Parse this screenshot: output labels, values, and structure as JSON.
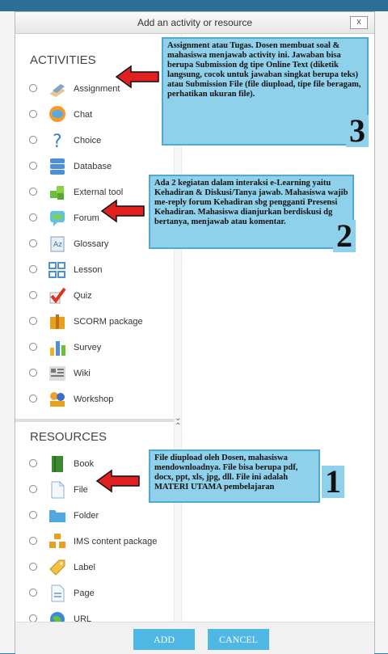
{
  "dialog": {
    "title": "Add an activity or resource",
    "close": "x",
    "add_label": "ADD",
    "cancel_label": "CANCEL"
  },
  "activities": {
    "title": "ACTIVITIES",
    "items": [
      {
        "label": "Assignment",
        "icon": "assignment-icon"
      },
      {
        "label": "Chat",
        "icon": "chat-icon"
      },
      {
        "label": "Choice",
        "icon": "choice-icon"
      },
      {
        "label": "Database",
        "icon": "database-icon"
      },
      {
        "label": "External tool",
        "icon": "external-tool-icon"
      },
      {
        "label": "Forum",
        "icon": "forum-icon"
      },
      {
        "label": "Glossary",
        "icon": "glossary-icon"
      },
      {
        "label": "Lesson",
        "icon": "lesson-icon"
      },
      {
        "label": "Quiz",
        "icon": "quiz-icon"
      },
      {
        "label": "SCORM package",
        "icon": "scorm-icon"
      },
      {
        "label": "Survey",
        "icon": "survey-icon"
      },
      {
        "label": "Wiki",
        "icon": "wiki-icon"
      },
      {
        "label": "Workshop",
        "icon": "workshop-icon"
      }
    ]
  },
  "resources": {
    "title": "RESOURCES",
    "items": [
      {
        "label": "Book",
        "icon": "book-icon"
      },
      {
        "label": "File",
        "icon": "file-icon"
      },
      {
        "label": "Folder",
        "icon": "folder-icon"
      },
      {
        "label": "IMS content package",
        "icon": "ims-icon"
      },
      {
        "label": "Label",
        "icon": "label-icon"
      },
      {
        "label": "Page",
        "icon": "page-icon"
      },
      {
        "label": "URL",
        "icon": "url-icon"
      }
    ]
  },
  "callouts": {
    "c3": {
      "text": "Assignment atau Tugas. Dosen membuat soal & mahasiswa menjawab activity ini. Jawaban bisa berupa Submission dg tipe Online Text (diketik langsung, cocok untuk jawaban singkat berupa teks) atau Submission File (file diupload, tipe file beragam, perhatikan ukuran file).",
      "num": "3"
    },
    "c2": {
      "text": "Ada 2 kegiatan dalam interaksi e-Learning yaitu Kehadiran & Diskusi/Tanya jawab. Mahasiswa wajib me-reply forum Kehadiran sbg pengganti Presensi Kehadiran. Mahasiswa dianjurkan berdiskusi dg bertanya, menjawab atau komentar.",
      "num": "2"
    },
    "c1": {
      "text": "File diupload oleh Dosen, mahasiswa mendownloadnya. File bisa berupa pdf, docx, ppt, xls, jpg, dll. File ini adalah MATERI UTAMA pembelajaran",
      "num": "1"
    }
  },
  "colors": {
    "accent": "#4eb7e4",
    "callout": "#8fd0ea",
    "arrow": "#e02020"
  }
}
